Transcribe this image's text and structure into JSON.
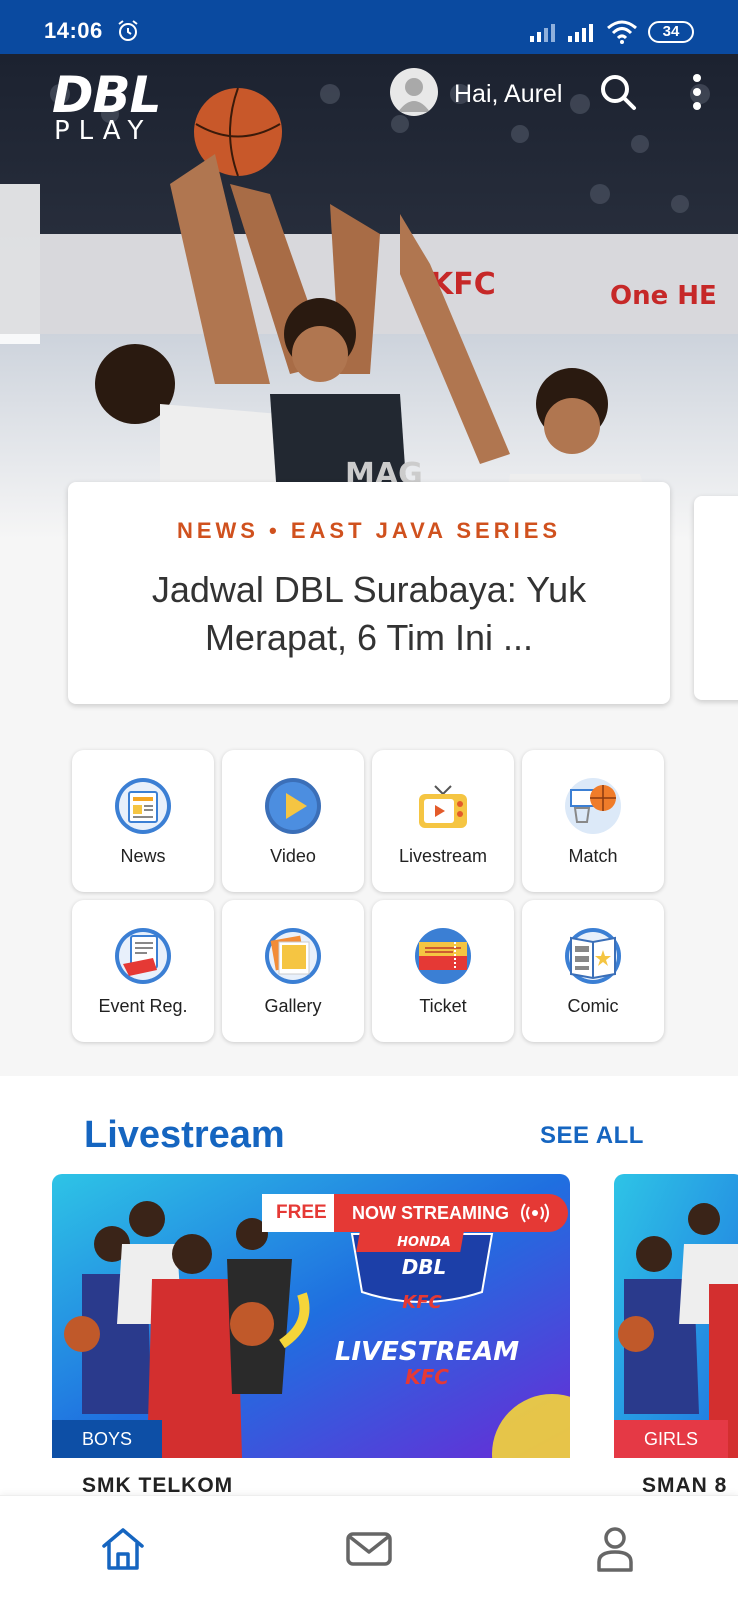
{
  "status_bar": {
    "time": "14:06",
    "battery": "34"
  },
  "header": {
    "logo_main": "DBL",
    "logo_sub": "PLAY",
    "greeting": "Hai, Aurel"
  },
  "featured_news": {
    "category": "NEWS • EAST JAVA SERIES",
    "title": "Jadwal DBL Surabaya: Yuk Merapat, 6 Tim Ini ..."
  },
  "menu": [
    {
      "label": "News",
      "icon": "news-icon"
    },
    {
      "label": "Video",
      "icon": "video-icon"
    },
    {
      "label": "Livestream",
      "icon": "livestream-icon"
    },
    {
      "label": "Match",
      "icon": "match-icon"
    },
    {
      "label": "Event Reg.",
      "icon": "event-reg-icon"
    },
    {
      "label": "Gallery",
      "icon": "gallery-icon"
    },
    {
      "label": "Ticket",
      "icon": "ticket-icon"
    },
    {
      "label": "Comic",
      "icon": "comic-icon"
    }
  ],
  "livestream": {
    "title": "Livestream",
    "see_all": "SEE ALL",
    "cards": [
      {
        "badge_free": "FREE",
        "badge_status": "NOW STREAMING",
        "banner_brand": "HONDA",
        "banner_logo": "DBL",
        "banner_with": "KFC",
        "banner_text": "LIVESTREAM",
        "banner_sponsor": "KFC",
        "tag": "BOYS",
        "caption": "SMK TELKOM"
      },
      {
        "tag": "GIRLS",
        "caption": "SMAN 8"
      }
    ]
  },
  "bottom_nav": [
    {
      "name": "home",
      "icon": "home-icon",
      "active": true
    },
    {
      "name": "messages",
      "icon": "mail-icon",
      "active": false
    },
    {
      "name": "profile",
      "icon": "user-icon",
      "active": false
    }
  ],
  "colors": {
    "primary": "#1565c0",
    "status_bar": "#0a4aa0",
    "accent_orange": "#d0511e",
    "live_red": "#e53935"
  }
}
